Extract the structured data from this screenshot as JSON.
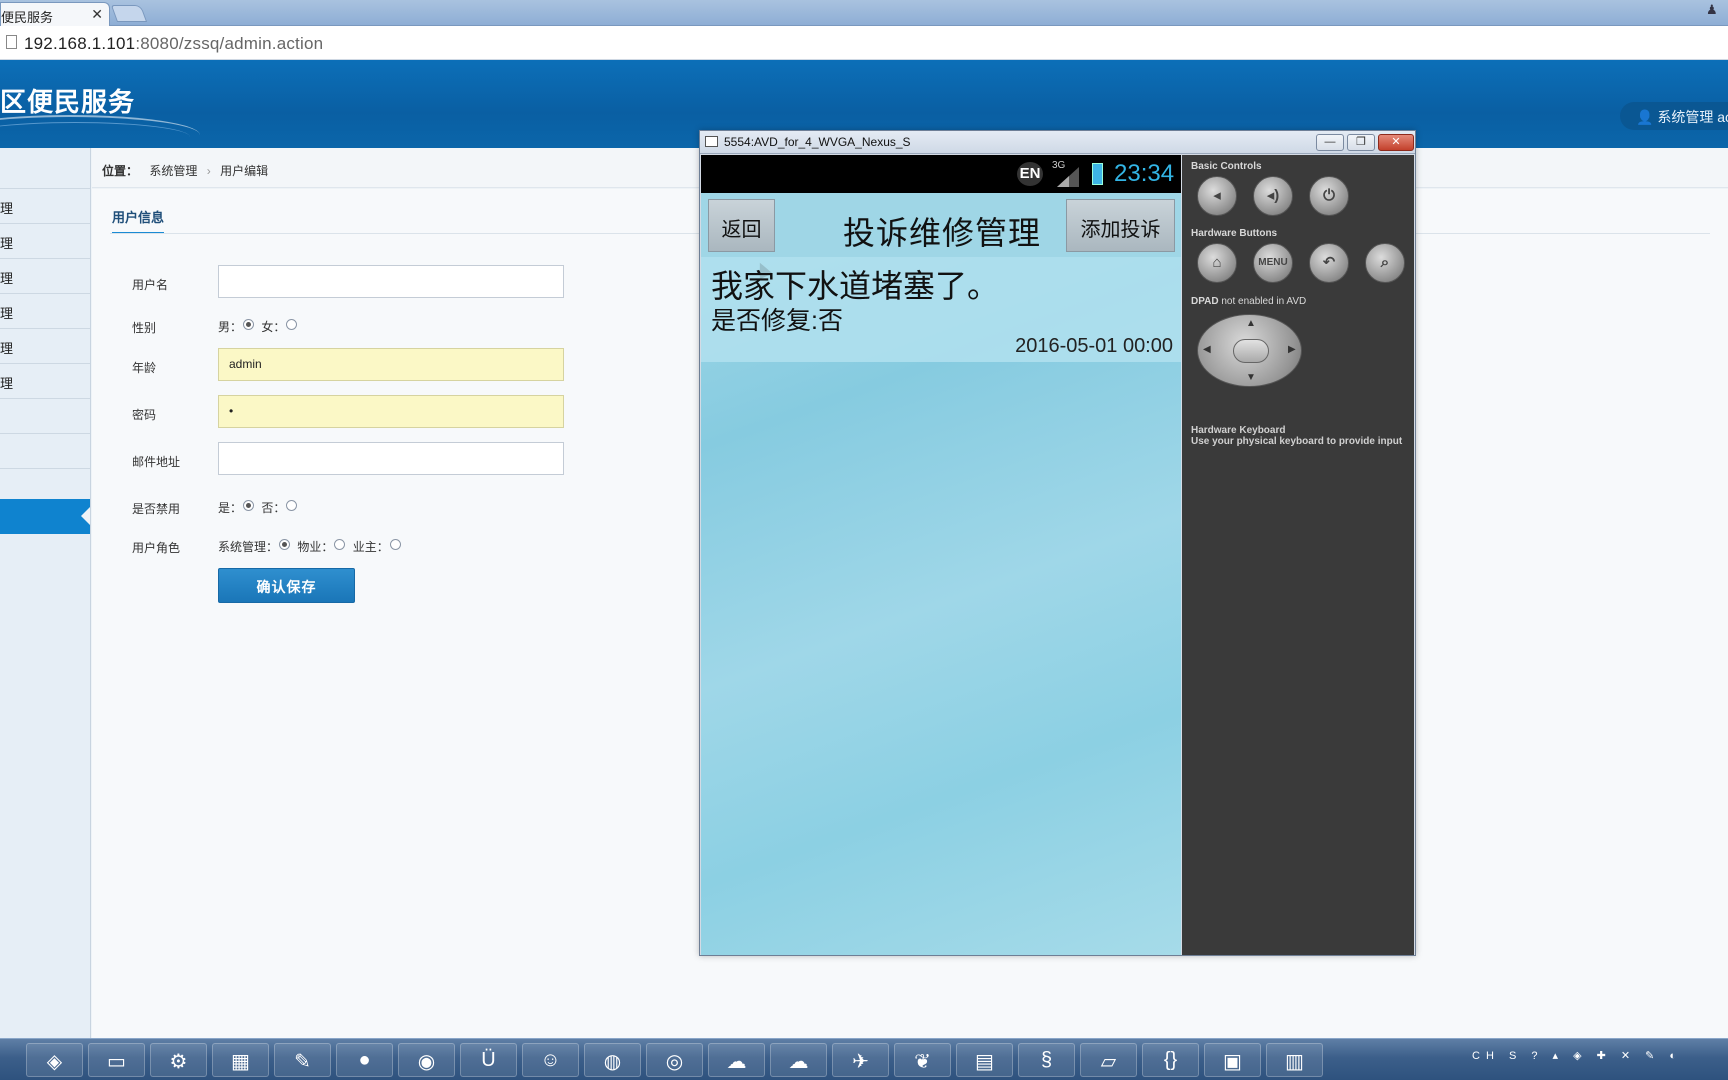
{
  "browser": {
    "tab_title": "便民服务",
    "tab_close": "✕",
    "url_host": "192.168.1.101",
    "url_rest": ":8080/zssq/admin.action"
  },
  "site": {
    "title": "区便民服务",
    "admin_label": "系统管理 ac",
    "user_icon": "user-icon"
  },
  "sidebar": {
    "items": [
      {
        "label": "理"
      },
      {
        "label": "理"
      },
      {
        "label": "理"
      },
      {
        "label": "理"
      },
      {
        "label": "理"
      },
      {
        "label": "理"
      },
      {
        "label": ""
      },
      {
        "label": ""
      }
    ]
  },
  "breadcrumb": {
    "label": "位置：",
    "path": [
      "系统管理",
      "用户编辑"
    ],
    "separator": "›"
  },
  "form": {
    "section_title": "用户信息",
    "fields": {
      "username": {
        "label": "用户名",
        "value": ""
      },
      "gender": {
        "label": "性别",
        "male": "男：",
        "female": "女："
      },
      "age": {
        "label": "年龄",
        "value": "admin"
      },
      "password": {
        "label": "密码",
        "value": "•"
      },
      "email": {
        "label": "邮件地址",
        "value": ""
      },
      "disabled": {
        "label": "是否禁用",
        "yes": "是：",
        "no": "否："
      },
      "role": {
        "label": "用户角色",
        "admin": "系统管理：",
        "property": "物业：",
        "owner": "业主："
      }
    },
    "save_label": "确认保存"
  },
  "emulator": {
    "window_title": "5554:AVD_for_4_WVGA_Nexus_S",
    "status": {
      "ime": "EN",
      "network": "3G",
      "time": "23:34"
    },
    "app": {
      "back_label": "返回",
      "title": "投诉维修管理",
      "add_label": "添加投诉",
      "items": [
        {
          "title": "我家下水道堵塞了。",
          "repaired": "是否修复:否",
          "date": "2016-05-01 00:00"
        }
      ]
    },
    "controls": {
      "basic_title": "Basic Controls",
      "hardware_title": "Hardware Buttons",
      "menu_label": "MENU",
      "dpad_title": "DPAD",
      "dpad_note": " not enabled in AVD",
      "keyboard_title": "Hardware Keyboard",
      "keyboard_note": "Use your physical keyboard to provide input"
    }
  },
  "taskbar": {
    "tray_text": "CH"
  }
}
